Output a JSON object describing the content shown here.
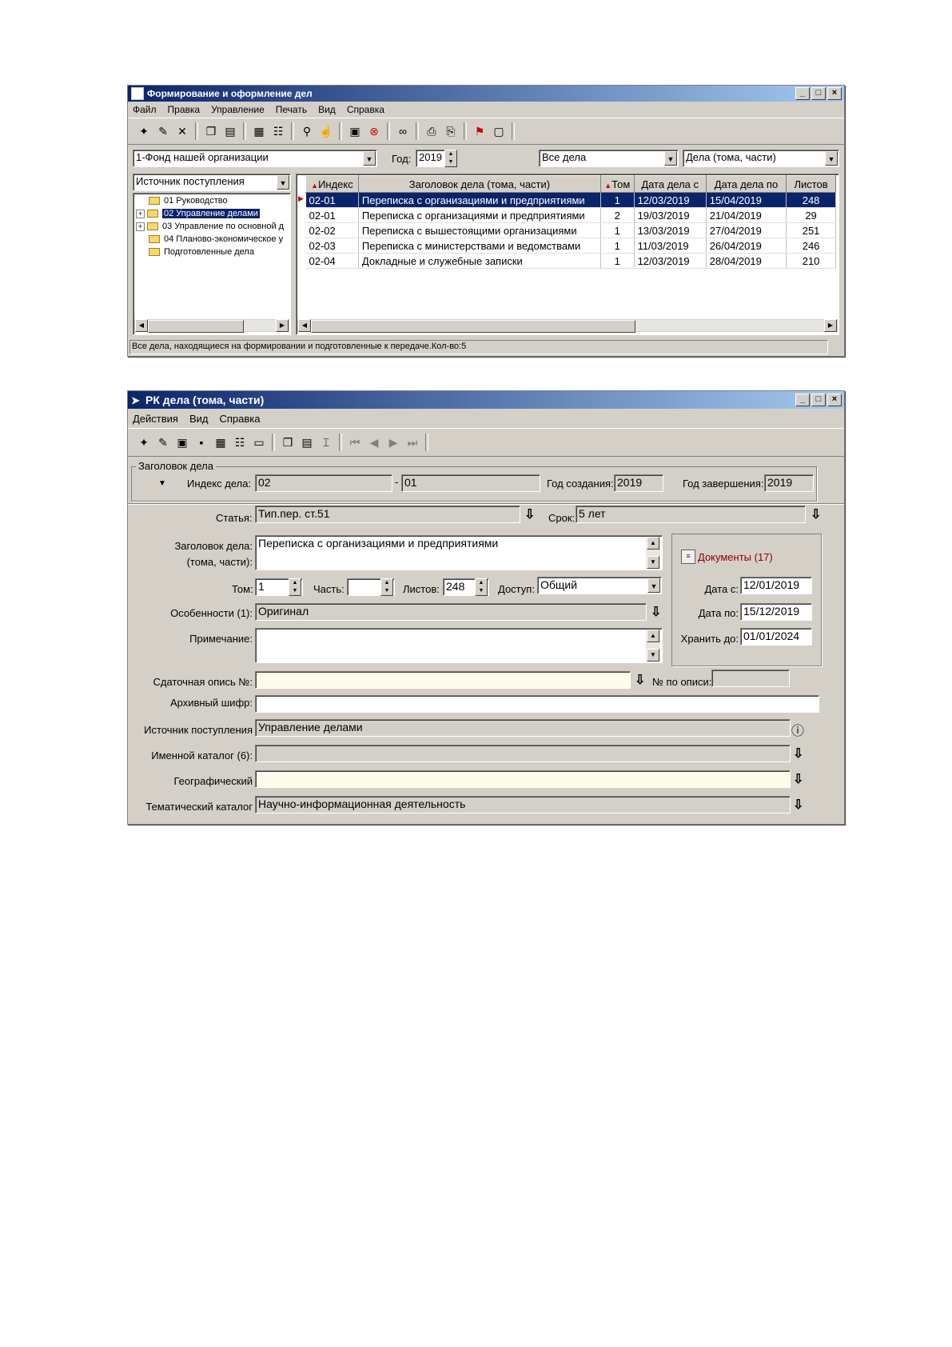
{
  "win1": {
    "title": "Формирование и оформление дел",
    "menu": [
      "Файл",
      "Правка",
      "Управление",
      "Печать",
      "Вид",
      "Справка"
    ],
    "fund_select": "1-Фонд нашей организации",
    "year_label": "Год:",
    "year_value": "2019",
    "filter_select": "Все дела",
    "type_select": "Дела (тома, части)",
    "source_select": "Источник поступления",
    "tree": [
      {
        "label": "01 Руководство",
        "expandable": false,
        "selected": false
      },
      {
        "label": "02 Управление делами",
        "expandable": true,
        "selected": true
      },
      {
        "label": "03 Управление по основной д",
        "expandable": true,
        "selected": false
      },
      {
        "label": "04 Планово-экономическое у",
        "expandable": false,
        "selected": false
      },
      {
        "label": "Подготовленные дела",
        "expandable": false,
        "selected": false
      }
    ],
    "columns": [
      "Индекс",
      "Заголовок дела (тома, части)",
      "Том",
      "Дата дела с",
      "Дата дела по",
      "Листов"
    ],
    "rows": [
      [
        "02-01",
        "Переписка с организациями и предприятиями",
        "1",
        "12/03/2019",
        "15/04/2019",
        "248"
      ],
      [
        "02-01",
        "Переписка с организациями и предприятиями",
        "2",
        "19/03/2019",
        "21/04/2019",
        "29"
      ],
      [
        "02-02",
        "Переписка с вышестоящими организациями",
        "1",
        "13/03/2019",
        "27/04/2019",
        "251"
      ],
      [
        "02-03",
        "Переписка с министерствами и ведомствами",
        "1",
        "11/03/2019",
        "26/04/2019",
        "246"
      ],
      [
        "02-04",
        "Докладные и служебные записки",
        "1",
        "12/03/2019",
        "28/04/2019",
        "210"
      ]
    ],
    "status": "Все дела, находящиеся на формировании и подготовленные к передаче.Кол-во:5"
  },
  "win2": {
    "title": "РК дела (тома, части)",
    "menu": [
      "Действия",
      "Вид",
      "Справка"
    ],
    "group_title": "Заголовок дела",
    "index_label": "Индекс дела:",
    "index_value1": "02",
    "index_dash": "-",
    "index_value2": "01",
    "year_created_label": "Год создания:",
    "year_created": "2019",
    "year_finished_label": "Год завершения:",
    "year_finished": "2019",
    "article_label": "Статья:",
    "article_value": "Тип.пер. ст.51",
    "term_label": "Срок:",
    "term_value": "5 лет",
    "title_label1": "Заголовок дела:",
    "title_label2": "(тома, части):",
    "title_value": "Переписка с организациями и предприятиями",
    "tom_label": "Том:",
    "tom_value": "1",
    "part_label": "Часть:",
    "part_value": "",
    "sheets_label": "Листов:",
    "sheets_value": "248",
    "access_label": "Доступ:",
    "access_value": "Общий",
    "features_label": "Особенности (1):",
    "features_value": "Оригинал",
    "note_label": "Примечание:",
    "note_value": "",
    "docs_link": "Документы (17)",
    "date_from_label": "Дата с:",
    "date_from": "12/01/2019",
    "date_to_label": "Дата по:",
    "date_to": "15/12/2019",
    "keep_label": "Хранить до:",
    "keep_value": "01/01/2024",
    "inventory_label": "Сдаточная опись №:",
    "inventory_value": "",
    "inv_no_label": "№ по описи:",
    "inv_no_value": "",
    "archive_label": "Архивный шифр:",
    "archive_value": "",
    "source_label": "Источник поступления",
    "source_value": "Управление делами",
    "names_label": "Именной каталог (6):",
    "names_value": "",
    "geo_label": "Географический",
    "geo_value": "",
    "topic_label": "Тематический каталог",
    "topic_value": "Научно-информационная деятельность"
  },
  "icons": {
    "dropdown": "▼",
    "pick": "⇩",
    "info": "ⓘ"
  }
}
